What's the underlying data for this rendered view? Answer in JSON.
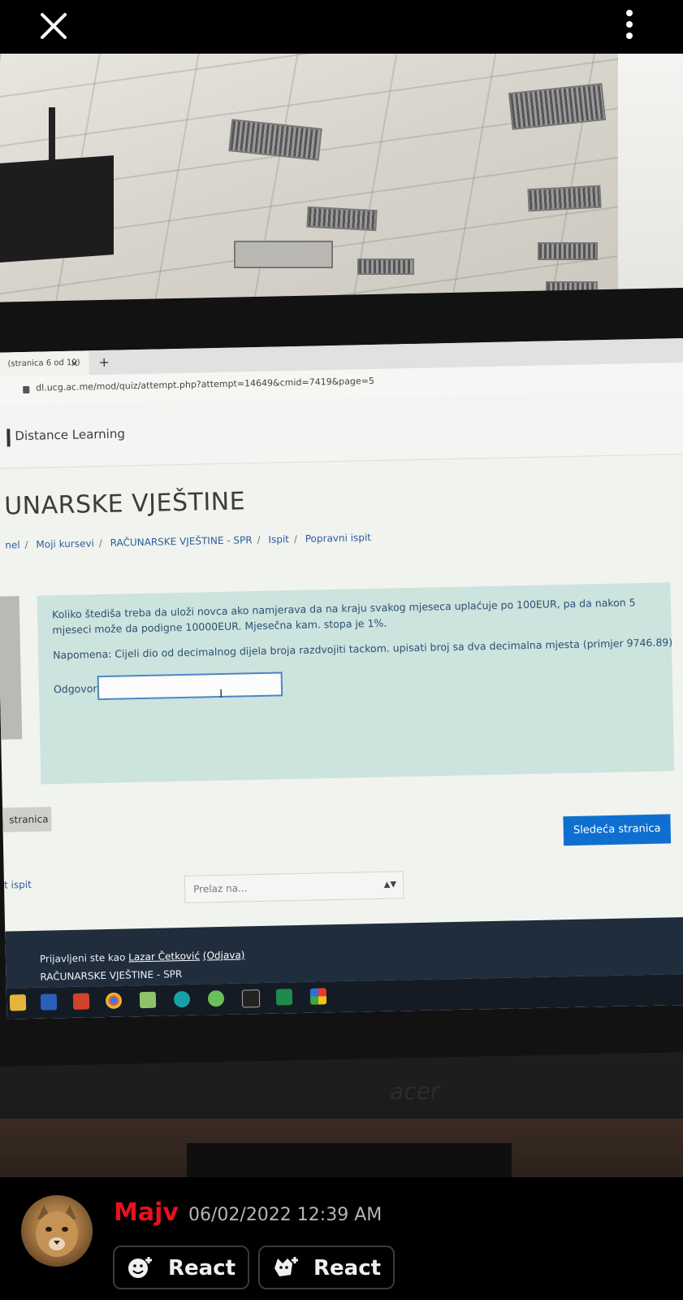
{
  "browser": {
    "tab_label": "(stranica 6 od 10)",
    "tab_close": "×",
    "new_tab": "+",
    "url": "dl.ucg.ac.me/mod/quiz/attempt.php?attempt=14649&cmid=7419&page=5"
  },
  "site": {
    "brand": "Distance Learning",
    "course_title": "UNARSKE VJEŠTINE",
    "breadcrumb": [
      "nel",
      "Moji kursevi",
      "RAČUNARSKE VJEŠTINE - SPR",
      "Ispit",
      "Popravni ispit"
    ]
  },
  "question": {
    "text": "Koliko štediša treba da uloži novca ako namjerava da na kraju svakog mjeseca uplaćuje po 100EUR, pa da nakon 5 mjeseci može da podigne 10000EUR. Mjesečna kam. stopa je 1%.",
    "note": "Napomena: Cijeli dio od decimalnog dijela broja razdvojiti tackom. upisati broj sa dva decimalna mjesta (primjer 9746.89)",
    "answer_label": "Odgovor:",
    "answer_value": ""
  },
  "navigation": {
    "prev_button": "stranica",
    "next_button": "Sledeća stranica",
    "back_link": "t ispit",
    "jump_placeholder": "Prelaz na..."
  },
  "footer": {
    "logged_in_prefix": "Prijavljeni ste kao",
    "user_name": "Lazar Četković",
    "logout": "(Odjava)",
    "course": "RAČUNARSKE VJEŠTINE - SPR"
  },
  "taskbar_icons": [
    "folder-icon",
    "word-icon",
    "powerpoint-icon",
    "chrome-icon",
    "notepad-icon",
    "arduino-icon",
    "android-studio-icon",
    "terminal-icon",
    "excel-icon",
    "app-grid-icon"
  ],
  "monitor_brand": "acer",
  "post": {
    "username": "Majv",
    "timestamp": "06/02/2022 12:39 AM",
    "react_label_1": "React",
    "react_label_2": "React"
  },
  "colors": {
    "username": "#e8121d",
    "next_button": "#0f6fd0",
    "question_bg": "#cde3de"
  }
}
